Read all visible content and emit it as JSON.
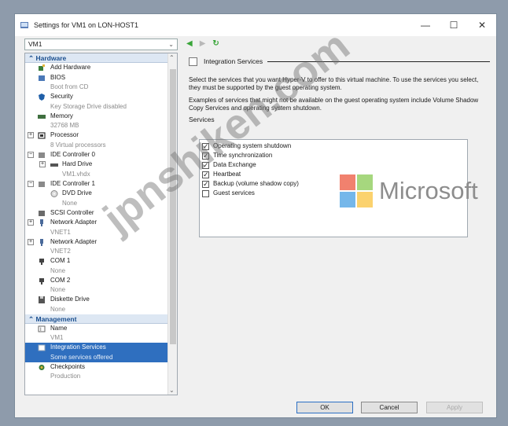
{
  "window": {
    "title": "Settings for VM1 on LON-HOST1",
    "controls": {
      "minimize": "—",
      "maximize": "☐",
      "close": "✕"
    }
  },
  "vm_selector": {
    "value": "VM1"
  },
  "nav": {
    "back": "◀",
    "forward": "▶",
    "refresh": "↻"
  },
  "sidebar": {
    "hardware_header": "Hardware",
    "management_header": "Management",
    "items": [
      {
        "label": "Add Hardware",
        "sub": ""
      },
      {
        "label": "BIOS",
        "sub": "Boot from CD"
      },
      {
        "label": "Security",
        "sub": "Key Storage Drive disabled"
      },
      {
        "label": "Memory",
        "sub": "32768 MB"
      },
      {
        "label": "Processor",
        "sub": "8 Virtual processors"
      },
      {
        "label": "IDE Controller 0",
        "sub": ""
      },
      {
        "label": "Hard Drive",
        "sub": "VM1.vhdx"
      },
      {
        "label": "IDE Controller 1",
        "sub": ""
      },
      {
        "label": "DVD Drive",
        "sub": "None"
      },
      {
        "label": "SCSI Controller",
        "sub": ""
      },
      {
        "label": "Network Adapter",
        "sub": "VNET1"
      },
      {
        "label": "Network Adapter",
        "sub": "VNET2"
      },
      {
        "label": "COM 1",
        "sub": "None"
      },
      {
        "label": "COM 2",
        "sub": "None"
      },
      {
        "label": "Diskette Drive",
        "sub": "None"
      }
    ],
    "management_items": [
      {
        "label": "Name",
        "sub": "VM1"
      },
      {
        "label": "Integration Services",
        "sub": "Some services offered"
      },
      {
        "label": "Checkpoints",
        "sub": "Production"
      }
    ]
  },
  "pane": {
    "title": "Integration Services",
    "intro": "Select the services that you want Hyper-V to offer to this virtual machine. To use the services you select, they must be supported by the guest operating system.",
    "examples": "Examples of services that might not be available on the guest operating system include Volume Shadow Copy Services and operating system shutdown.",
    "services_label": "Services",
    "services": [
      {
        "label": "Operating system shutdown",
        "checked": true
      },
      {
        "label": "Time synchronization",
        "checked": true
      },
      {
        "label": "Data Exchange",
        "checked": true
      },
      {
        "label": "Heartbeat",
        "checked": true
      },
      {
        "label": "Backup (volume shadow copy)",
        "checked": true
      },
      {
        "label": "Guest services",
        "checked": false
      }
    ]
  },
  "buttons": {
    "ok": "OK",
    "cancel": "Cancel",
    "apply": "Apply"
  },
  "overlay": {
    "watermark": "jpnshiken.com",
    "logo_text": "Microsoft"
  },
  "colors": {
    "selection": "#2f6fbf",
    "section_header": "#1b4f8f",
    "nav_green": "#3aa63a"
  }
}
